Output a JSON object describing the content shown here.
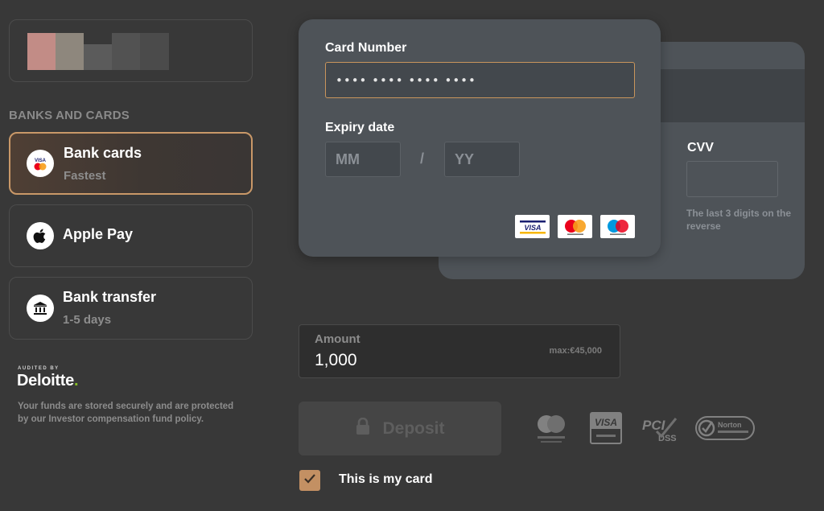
{
  "sidebar": {
    "section_title": "BANKS AND CARDS",
    "methods": [
      {
        "title": "Bank cards",
        "subtitle": "Fastest",
        "icon": "bank-card-icon",
        "active": true
      },
      {
        "title": "Apple Pay",
        "subtitle": "",
        "icon": "apple-icon",
        "active": false
      },
      {
        "title": "Bank transfer",
        "subtitle": "1-5 days",
        "icon": "bank-building-icon",
        "active": false
      }
    ],
    "audited_by": "AUDITED BY",
    "auditor": "Deloitte",
    "auditor_dot": ".",
    "security_note": "Your funds are stored securely and are protected by our Investor compensation fund policy."
  },
  "card_form": {
    "card_number_label": "Card Number",
    "card_number_placeholder": "•••• •••• •••• ••••",
    "expiry_label": "Expiry date",
    "month_placeholder": "MM",
    "year_placeholder": "YY",
    "separator": "/",
    "cvv_label": "CVV",
    "cvv_hint": "The last 3 digits on the reverse",
    "brands": [
      {
        "name": "VISA",
        "icon": "visa-icon"
      },
      {
        "name": "mastercard",
        "icon": "mastercard-icon"
      },
      {
        "name": "maestro",
        "icon": "maestro-icon"
      }
    ]
  },
  "amount": {
    "label": "Amount",
    "value": "1,000",
    "max": "max:€45,000"
  },
  "deposit": {
    "label": "Deposit",
    "enabled": false
  },
  "trust_badges": [
    {
      "name": "mastercard-securecode",
      "icon": "mastercard-securecode-icon"
    },
    {
      "name": "verified-by-visa",
      "icon": "visa-verified-icon",
      "text": "VISA"
    },
    {
      "name": "pci-dss",
      "icon": "pci-dss-icon",
      "text": "PCI",
      "subtext": "DSS"
    },
    {
      "name": "norton-secured",
      "icon": "norton-icon",
      "text": "Norton"
    }
  ],
  "confirm_card": {
    "label": "This is my card",
    "checked": true
  },
  "colors": {
    "background": "#383838",
    "accent": "#c99868",
    "card": "#4e5358",
    "deloitte_green": "#86bc25"
  }
}
